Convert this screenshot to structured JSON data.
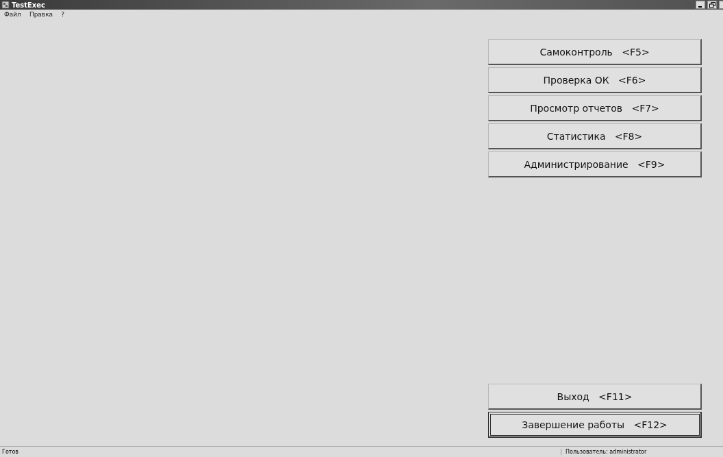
{
  "window": {
    "title": "TestExec"
  },
  "menu": [
    "Файл",
    "Правка",
    "?"
  ],
  "main_buttons": [
    {
      "label": "Самоконтроль   <F5>",
      "focused": false
    },
    {
      "label": "Проверка ОК   <F6>",
      "focused": false
    },
    {
      "label": "Просмотр отчетов   <F7>",
      "focused": false
    },
    {
      "label": "Статистика   <F8>",
      "focused": false
    },
    {
      "label": "Администрирование   <F9>",
      "focused": false
    }
  ],
  "bottom_buttons": [
    {
      "label": "Выход   <F11>",
      "focused": false
    },
    {
      "label": "Завершение работы   <F12>",
      "focused": true
    }
  ],
  "status_bar": {
    "message": "Готов",
    "user": "Пользователь: administrator"
  }
}
